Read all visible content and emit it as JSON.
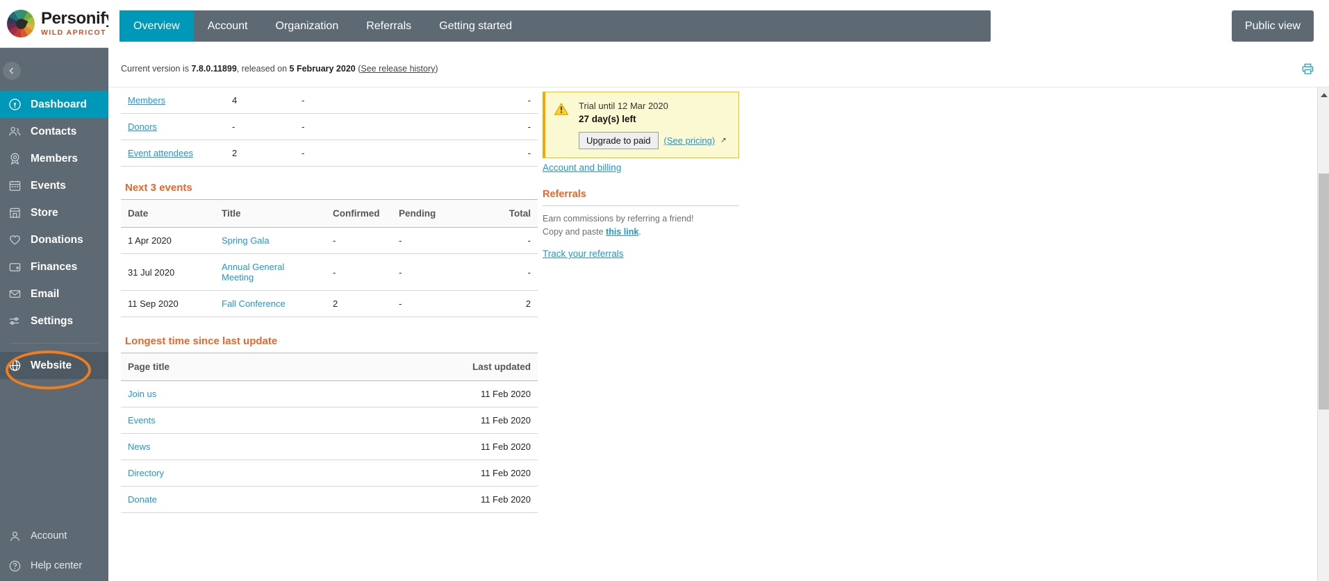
{
  "brand": {
    "name": "Personify",
    "tagline": "WILD APRICOT",
    "accent": "#0098b8",
    "orange": "#e8672a"
  },
  "sidebar": {
    "collapse_label": "collapse-sidebar",
    "items": [
      {
        "label": "Dashboard",
        "icon": "gauge-icon",
        "active": true
      },
      {
        "label": "Contacts",
        "icon": "contacts-icon",
        "active": false
      },
      {
        "label": "Members",
        "icon": "member-badge-icon",
        "active": false
      },
      {
        "label": "Events",
        "icon": "calendar-icon",
        "active": false
      },
      {
        "label": "Store",
        "icon": "store-icon",
        "active": false
      },
      {
        "label": "Donations",
        "icon": "heart-icon",
        "active": false
      },
      {
        "label": "Finances",
        "icon": "wallet-icon",
        "active": false
      },
      {
        "label": "Email",
        "icon": "envelope-icon",
        "active": false
      },
      {
        "label": "Settings",
        "icon": "sliders-icon",
        "active": false
      }
    ],
    "website": {
      "label": "Website",
      "icon": "globe-icon",
      "highlighted": true
    },
    "bottom_items": [
      {
        "label": "Account",
        "icon": "person-icon"
      },
      {
        "label": "Help center",
        "icon": "question-circle-icon"
      }
    ]
  },
  "topbar": {
    "tabs": [
      {
        "label": "Overview",
        "active": true
      },
      {
        "label": "Account",
        "active": false
      },
      {
        "label": "Organization",
        "active": false
      },
      {
        "label": "Referrals",
        "active": false
      },
      {
        "label": "Getting started",
        "active": false
      }
    ],
    "public_view_label": "Public view"
  },
  "versionbar": {
    "prefix": "Current version is ",
    "version": "7.8.0.11899",
    "middle": ", released on ",
    "release_date": "5 February 2020",
    "open_paren": " (",
    "release_history_link": "See release history",
    "close_paren": ")",
    "print_icon": "printer-icon"
  },
  "summary_table": {
    "rows": [
      {
        "label": "Members",
        "c2": "4",
        "c3": "-",
        "c4": "-"
      },
      {
        "label": "Donors",
        "c2": "-",
        "c3": "-",
        "c4": "-"
      },
      {
        "label": "Event attendees",
        "c2": "2",
        "c3": "-",
        "c4": "-"
      }
    ]
  },
  "events_section": {
    "title": "Next 3 events",
    "headers": [
      "Date",
      "Title",
      "Confirmed",
      "Pending",
      "Total"
    ],
    "rows": [
      {
        "date": "1 Apr 2020",
        "title": "Spring Gala",
        "confirmed": "-",
        "pending": "-",
        "total": "-"
      },
      {
        "date": "31 Jul 2020",
        "title": "Annual General Meeting",
        "confirmed": "-",
        "pending": "-",
        "total": "-"
      },
      {
        "date": "11 Sep 2020",
        "title": "Fall Conference",
        "confirmed": "2",
        "pending": "-",
        "total": "2"
      }
    ]
  },
  "pages_section": {
    "title": "Longest time since last update",
    "headers": [
      "Page title",
      "Last updated"
    ],
    "rows": [
      {
        "page": "Join us",
        "updated": "11 Feb 2020"
      },
      {
        "page": "Events",
        "updated": "11 Feb 2020"
      },
      {
        "page": "News",
        "updated": "11 Feb 2020"
      },
      {
        "page": "Directory",
        "updated": "11 Feb 2020"
      },
      {
        "page": "Donate",
        "updated": "11 Feb 2020"
      }
    ]
  },
  "trial": {
    "icon": "warning-triangle-icon",
    "line1": "Trial until 12 Mar 2020",
    "line2": "27 day(s) left",
    "upgrade_label": "Upgrade to paid",
    "pricing_label": "(See pricing)",
    "external_marker": "↗"
  },
  "account_billing_link": "Account and billing",
  "referrals": {
    "title": "Referrals",
    "line1": "Earn commissions by referring a friend!",
    "line2_prefix": "Copy and paste ",
    "link": "this link",
    "line2_suffix": ".",
    "track_link": "Track your referrals"
  }
}
